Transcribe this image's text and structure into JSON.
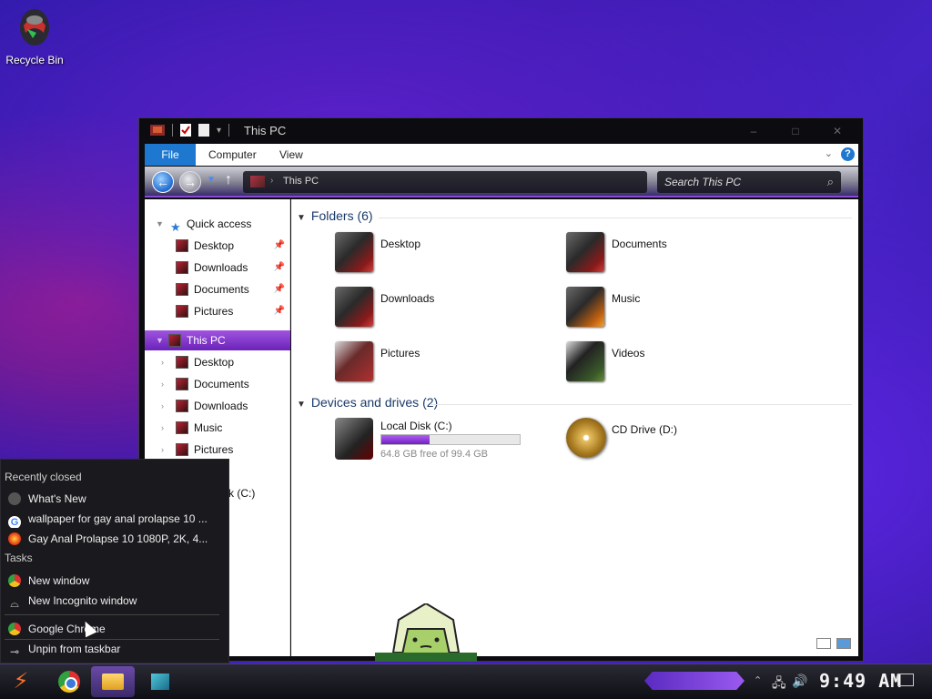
{
  "desktop": {
    "recycle_bin_label": "Recycle Bin"
  },
  "window": {
    "title": "This PC",
    "ribbon": {
      "tabs": [
        "File",
        "Computer",
        "View"
      ]
    },
    "address": {
      "crumb": "This PC"
    },
    "search": {
      "placeholder": "Search This PC"
    },
    "nav_pane": {
      "quick_access_label": "Quick access",
      "quick_access_items": [
        "Desktop",
        "Downloads",
        "Documents",
        "Pictures"
      ],
      "this_pc_label": "This PC",
      "this_pc_items": [
        "Desktop",
        "Documents",
        "Downloads",
        "Music",
        "Pictures"
      ],
      "partial_item": "sk (C:)"
    },
    "content": {
      "folders_header": "Folders (6)",
      "folders": [
        "Desktop",
        "Documents",
        "Downloads",
        "Music",
        "Pictures",
        "Videos"
      ],
      "drives_header": "Devices and drives (2)",
      "drives": [
        {
          "name": "Local Disk (C:)",
          "free_text": "64.8 GB free of 99.4 GB",
          "used_fraction": 0.35
        },
        {
          "name": "CD Drive (D:)"
        }
      ]
    }
  },
  "jumplist": {
    "recently_closed_label": "Recently closed",
    "recently_closed": [
      "What's New",
      "wallpaper for gay anal prolapse 10 ...",
      "Gay Anal Prolapse 10 1080P, 2K, 4..."
    ],
    "tasks_label": "Tasks",
    "tasks": [
      "New window",
      "New Incognito window"
    ],
    "app_label": "Google Chrome",
    "unpin_label": "Unpin from taskbar"
  },
  "taskbar": {
    "clock": "9:49 AM"
  },
  "colors": {
    "accent": "#8a4ad8",
    "selection": "#6a22b8",
    "file_tab": "#1e78d0"
  }
}
